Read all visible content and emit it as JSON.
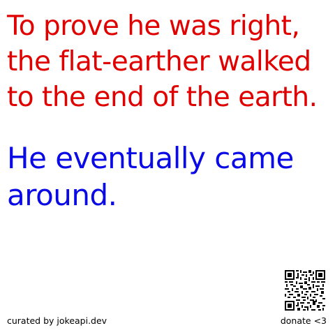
{
  "joke": {
    "setup": "To prove he was right, the flat-earther walked to the end of the earth.",
    "delivery": "He eventually came around."
  },
  "footer": {
    "credit": "curated by jokeapi.dev",
    "donate": "donate <3"
  },
  "colors": {
    "setup": "#e00000",
    "delivery": "#0a0ae6",
    "background": "#ffffff"
  },
  "icons": {
    "qr": "qr-code-icon"
  }
}
